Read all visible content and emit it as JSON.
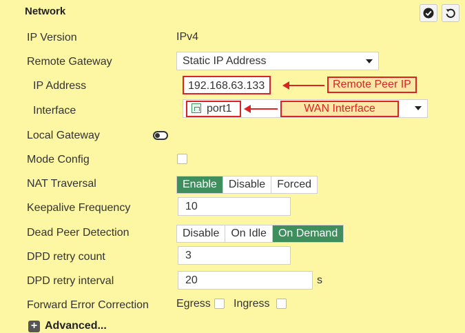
{
  "section": {
    "title": "Network",
    "apply_icon": "check-circle-icon",
    "revert_icon": "undo-icon"
  },
  "rows": {
    "ip_version": {
      "label": "IP Version",
      "value": "IPv4"
    },
    "remote_gateway": {
      "label": "Remote Gateway",
      "value": "Static IP Address"
    },
    "ip_address": {
      "label": "IP Address",
      "value": "192.168.63.133"
    },
    "interface": {
      "label": "Interface",
      "value": "port1"
    },
    "local_gateway": {
      "label": "Local Gateway",
      "enabled": false
    },
    "mode_config": {
      "label": "Mode Config",
      "checked": false
    },
    "nat_traversal": {
      "label": "NAT Traversal",
      "options": [
        "Enable",
        "Disable",
        "Forced"
      ],
      "selected": "Enable"
    },
    "keepalive": {
      "label": "Keepalive Frequency",
      "value": "10"
    },
    "dpd": {
      "label": "Dead Peer Detection",
      "options": [
        "Disable",
        "On Idle",
        "On Demand"
      ],
      "selected": "On Demand"
    },
    "dpd_retry_count": {
      "label": "DPD retry count",
      "value": "3"
    },
    "dpd_retry_interval": {
      "label": "DPD retry interval",
      "value": "20",
      "unit": "s"
    },
    "fec": {
      "label": "Forward Error Correction",
      "egress_label": "Egress",
      "ingress_label": "Ingress",
      "egress_checked": false,
      "ingress_checked": false
    }
  },
  "advanced": {
    "label": "Advanced..."
  },
  "annotations": {
    "remote_peer": "Remote Peer IP",
    "wan_interface": "WAN Interface"
  },
  "colors": {
    "background": "#fdf6a3",
    "accent": "#3e8e5e",
    "annotation": "#d22222"
  }
}
